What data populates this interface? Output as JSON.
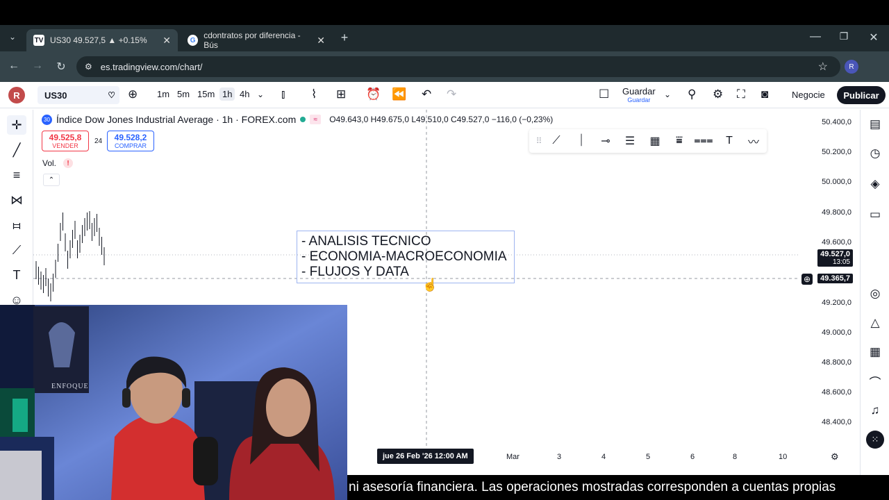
{
  "browser": {
    "tabs": [
      {
        "title": "US30 49.527,5 ▲ +0.15%",
        "icon": "tradingview-favicon"
      },
      {
        "title": "cdontratos por diferencia - Bús",
        "icon": "google-favicon"
      }
    ],
    "url": "es.tradingview.com/chart/",
    "profile_initial": "R"
  },
  "tv": {
    "user_initial": "R",
    "symbol": "US30",
    "timeframes": [
      "1m",
      "5m",
      "15m",
      "1h",
      "4h"
    ],
    "selected_timeframe": "1h",
    "save_label": "Guardar",
    "save_sublabel": "Guardar",
    "trade_label": "Negocie",
    "publish_label": "Publicar"
  },
  "legend": {
    "badge": "30",
    "title": "Índice Dow Jones Industrial Average · 1h · FOREX.com",
    "ohlc": "O49.643,0  H49.675,0  L49.510,0  C49.527,0  −116,0 (−0,23%)",
    "sell_price": "49.525,8",
    "sell_label": "VENDER",
    "spread": "24",
    "buy_price": "49.528,2",
    "buy_label": "COMPRAR",
    "volume_label": "Vol."
  },
  "price_scale": {
    "labels": [
      "50.400,0",
      "50.200,0",
      "50.000,0",
      "49.800,0",
      "49.600,0",
      "49.200,0",
      "49.000,0",
      "48.800,0",
      "48.600,0",
      "48.400,0"
    ],
    "last_price": "49.527,0",
    "countdown": "13:05",
    "crosshair_price": "49.365,7"
  },
  "time_scale": {
    "crosshair_time": "jue 26 Feb '26   12:00 AM",
    "labels": [
      "Mar",
      "3",
      "4",
      "5",
      "6",
      "8",
      "10"
    ]
  },
  "annotation": {
    "lines": [
      "- ANALISIS TECNICO",
      "- ECONOMIA-MACROECONOMIA",
      "- FLUJOS Y DATA"
    ]
  },
  "webcam": {
    "poster_text": "ENFOQUE"
  },
  "caption": "ni asesoría financiera. Las operaciones mostradas corresponden a cuentas propias",
  "colors": {
    "sell": "#f23645",
    "buy": "#2962ff",
    "chrome_dark": "#1f2a2e",
    "chrome_mid": "#35444a"
  }
}
